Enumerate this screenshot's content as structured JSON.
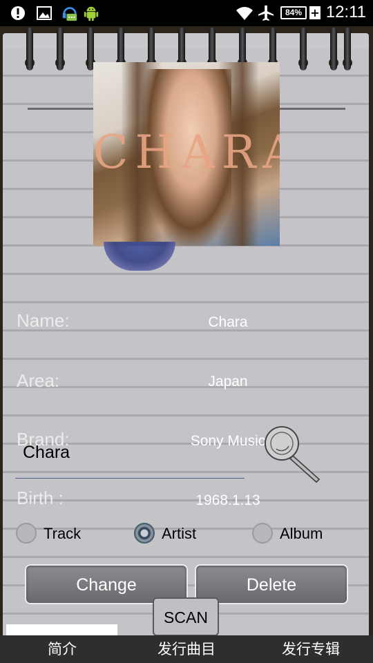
{
  "statusbar": {
    "icons": [
      "alert-icon",
      "image-icon",
      "headset-chat-icon",
      "android-icon",
      "wifi-icon",
      "airplane-icon"
    ],
    "battery": "84%",
    "time": "12:11"
  },
  "album": {
    "art_text": "CHARA"
  },
  "info": {
    "name_label": "Name:",
    "name_value": "Chara",
    "area_label": "Area:",
    "area_value": "Japan",
    "brand_label": "Brand:",
    "brand_value": "Sony Music",
    "birth_label": "Birth :",
    "birth_value": "1968.1.13"
  },
  "search_input": {
    "value": "Chara"
  },
  "search_type": {
    "options": [
      "Track",
      "Artist",
      "Album"
    ],
    "selected": "Artist"
  },
  "actions": {
    "change_label": "Change",
    "delete_label": "Delete",
    "scan_label": "SCAN"
  },
  "tabs": [
    {
      "label": "简介"
    },
    {
      "label": "发行曲目"
    },
    {
      "label": "发行专辑"
    }
  ],
  "colors": {
    "status_bar": "#000000",
    "paper": "#c4c4c8",
    "tab_bar": "#2e2e2e",
    "button": "#7a7a7e"
  }
}
